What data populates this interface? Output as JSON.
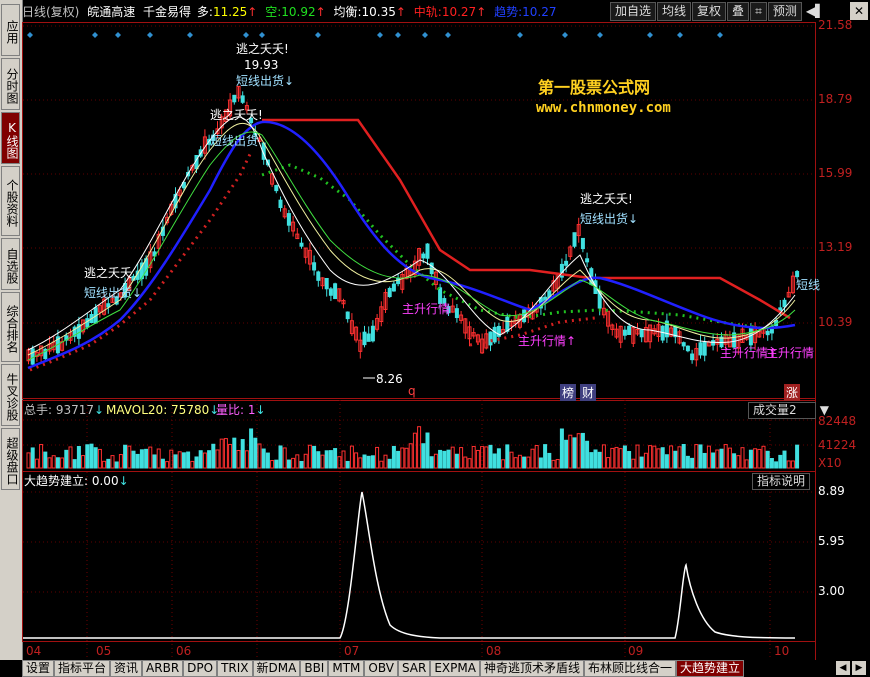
{
  "sidebar": {
    "tabs": [
      {
        "label": "应用",
        "active": false
      },
      {
        "label": "分时图",
        "active": false
      },
      {
        "label": "K线图",
        "active": true
      },
      {
        "label": "个股资料",
        "active": false
      },
      {
        "label": "自选股",
        "active": false
      },
      {
        "label": "综合排名",
        "active": false
      },
      {
        "label": "牛叉诊股",
        "active": false
      },
      {
        "label": "超级盘口",
        "active": false
      }
    ]
  },
  "header": {
    "period": "日线(复权)",
    "stock": "皖通高速",
    "indicator": "千金易得",
    "long_label": "多:",
    "long_value": "11.25",
    "short_label": "空:",
    "short_value": "10.92",
    "avg_label": "均衡:",
    "avg_value": "10.35",
    "mid_label": "中轨:",
    "mid_value": "10.27",
    "trend_label": "趋势:",
    "trend_value": "10.27"
  },
  "toolbar": {
    "add_watch": "加自选",
    "ma": "均线",
    "restore": "复权",
    "overlay": "叠",
    "crop_icon": "crop-icon",
    "forecast": "预测",
    "more_icon": "play-icon"
  },
  "close_label": "✕",
  "main_chart": {
    "right_axis": [
      "21.58",
      "18.79",
      "15.99",
      "13.19",
      "10.39"
    ],
    "watermark_title": "第一股票公式网",
    "watermark_url": "www.chnmoney.com",
    "annotations": [
      {
        "text": "逃之夭夭!",
        "color": "#ffffff"
      },
      {
        "text": "19.93",
        "color": "#ffffff"
      },
      {
        "text": "短线出货↓",
        "color": "#a0e0ff"
      },
      {
        "text": "逃之夭夭!",
        "color": "#ffffff"
      },
      {
        "text": "短线出货",
        "color": "#a0e0ff"
      },
      {
        "text": "逃之夭夭",
        "color": "#ffffff"
      },
      {
        "text": "短线出货↓",
        "color": "#a0e0ff"
      },
      {
        "text": "逃之夭夭!",
        "color": "#ffffff"
      },
      {
        "text": "短线出货↓",
        "color": "#a0e0ff"
      },
      {
        "text": "主升行情↑",
        "color": "#ff40ff"
      },
      {
        "text": "主升行情",
        "color": "#ff40ff"
      },
      {
        "text": "主升行情↑",
        "color": "#ff40ff"
      },
      {
        "text": "主升行情",
        "color": "#ff40ff"
      },
      {
        "text": "8.26",
        "color": "#ffffff"
      },
      {
        "text": "短线",
        "color": "#a0e0ff"
      },
      {
        "text": "q",
        "color": "#ff4040"
      },
      {
        "text": "榜",
        "color": "#ffffff"
      },
      {
        "text": "财",
        "color": "#ffffff"
      },
      {
        "text": "涨",
        "color": "#ffffff"
      }
    ]
  },
  "volume_panel": {
    "total_label": "总手: 93717",
    "mavol_label": "MAVOL20: 75780",
    "ratio_label": "量比: 1",
    "selector": "成交量2",
    "axis": [
      "82448",
      "41224",
      "X10"
    ]
  },
  "indicator_panel": {
    "title": "大趋势建立: 0.00",
    "help": "指标说明",
    "axis": [
      "8.89",
      "5.95",
      "3.00"
    ]
  },
  "x_axis": [
    "04",
    "05",
    "06",
    "07",
    "08",
    "09",
    "10"
  ],
  "bottom_tabs": [
    {
      "label": "设置",
      "active": false
    },
    {
      "label": "指标平台",
      "active": false
    },
    {
      "label": "资讯",
      "active": false
    },
    {
      "label": "ARBR",
      "active": false
    },
    {
      "label": "DPO",
      "active": false
    },
    {
      "label": "TRIX",
      "active": false
    },
    {
      "label": "新DMA",
      "active": false
    },
    {
      "label": "BBI",
      "active": false
    },
    {
      "label": "MTM",
      "active": false
    },
    {
      "label": "OBV",
      "active": false
    },
    {
      "label": "SAR",
      "active": false
    },
    {
      "label": "EXPMA",
      "active": false
    },
    {
      "label": "神奇逃顶术矛盾线",
      "active": false
    },
    {
      "label": "布林顾比线合一",
      "active": false
    },
    {
      "label": "大趋势建立",
      "active": true
    }
  ],
  "colors": {
    "up": "#ff3030",
    "down": "#40e0e0",
    "ma_blue": "#2020ff",
    "ma_red": "#e02020",
    "sar": "#d02020",
    "green_star": "#20c020",
    "grid": "#800000",
    "accent": "#800000"
  }
}
